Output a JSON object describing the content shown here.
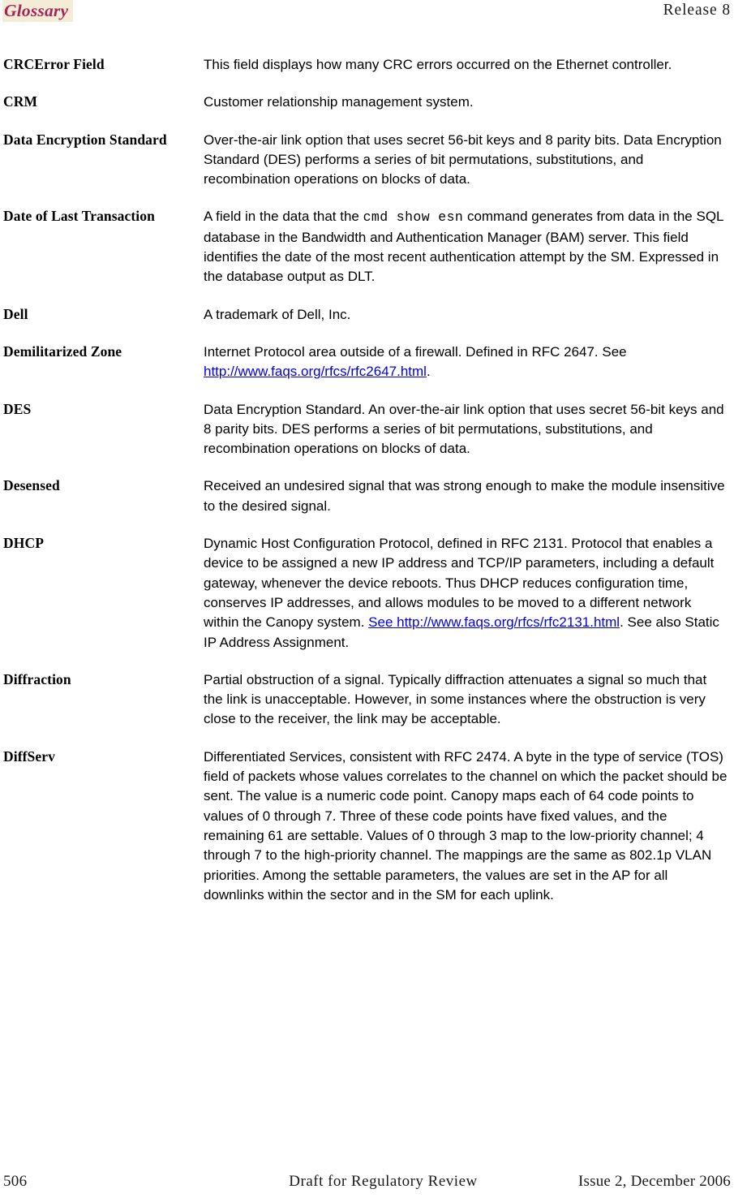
{
  "header": {
    "chapter_title": "Glossary",
    "release_label": "Release 8",
    "chapter_title_color": "#a32858",
    "chapter_highlight_color": "#f5ecd8"
  },
  "footer": {
    "page_number": "506",
    "center_text": "Draft for Regulatory Review",
    "issue_text": "Issue 2, December 2006"
  },
  "link_color": "#0000ee",
  "glossary": {
    "entries": [
      {
        "term": "CRCError Field",
        "definition": "This field displays how many CRC errors occurred on the Ethernet controller."
      },
      {
        "term": "CRM",
        "definition": "Customer relationship management system."
      },
      {
        "term": "Data Encryption Standard",
        "definition": "Over-the-air link option that uses secret 56-bit keys and 8 parity bits. Data Encryption Standard (DES) performs a series of bit permutations, substitutions, and recombination operations on blocks of data."
      },
      {
        "term": "Date of Last Transaction",
        "definition_parts": [
          {
            "type": "text",
            "text": "A field in the data that the "
          },
          {
            "type": "code",
            "text": "cmd show esn"
          },
          {
            "type": "text",
            "text": " command generates from data in the SQL database in the Bandwidth and Authentication Manager (BAM) server. This field identifies the date of the most recent authentication attempt by the SM. Expressed in the database output as DLT."
          }
        ]
      },
      {
        "term": "Dell",
        "definition": "A trademark of Dell, Inc."
      },
      {
        "term": "Demilitarized Zone",
        "definition_parts": [
          {
            "type": "text",
            "text": "Internet Protocol area outside of a firewall. Defined in RFC 2647. See "
          },
          {
            "type": "link",
            "text": "http://www.faqs.org/rfcs/rfc2647.html"
          },
          {
            "type": "text",
            "text": "."
          }
        ]
      },
      {
        "term": "DES",
        "definition": "Data Encryption Standard. An over-the-air link option that uses secret 56-bit keys and 8 parity bits. DES performs a series of bit permutations, substitutions, and recombination operations on blocks of data."
      },
      {
        "term": "Desensed",
        "definition": "Received an undesired signal that was strong enough to make the module insensitive to the desired signal."
      },
      {
        "term": "DHCP",
        "definition_parts": [
          {
            "type": "text",
            "text": "Dynamic Host Configuration Protocol, defined in RFC 2131. Protocol that enables a device to be assigned a new IP address and TCP/IP parameters, including a default gateway, whenever the device reboots. Thus DHCP reduces configuration time, conserves IP addresses, and allows modules to be moved to a different network within the Canopy system. "
          },
          {
            "type": "link",
            "text": "See http://www.faqs.org/rfcs/rfc2131.html"
          },
          {
            "type": "text",
            "text": ". See also Static IP Address Assignment."
          }
        ]
      },
      {
        "term": "Diffraction",
        "definition": "Partial obstruction of a signal. Typically diffraction attenuates a signal so much that the link is unacceptable. However, in some instances where the obstruction is very close to the receiver, the link may be acceptable."
      },
      {
        "term": "DiffServ",
        "definition": "Differentiated Services, consistent with RFC 2474. A byte in the type of service (TOS) field of packets whose values correlates to the channel on which the packet should be sent. The value is a numeric code point. Canopy maps each of 64 code points to values of 0 through 7. Three of these code points have fixed values, and the remaining 61 are settable. Values of 0 through 3 map to the low-priority channel; 4 through 7 to the high-priority channel. The mappings are the same as 802.1p VLAN priorities. Among the settable parameters, the values are set in the AP for all downlinks within the sector and in the SM for each uplink."
      }
    ]
  }
}
